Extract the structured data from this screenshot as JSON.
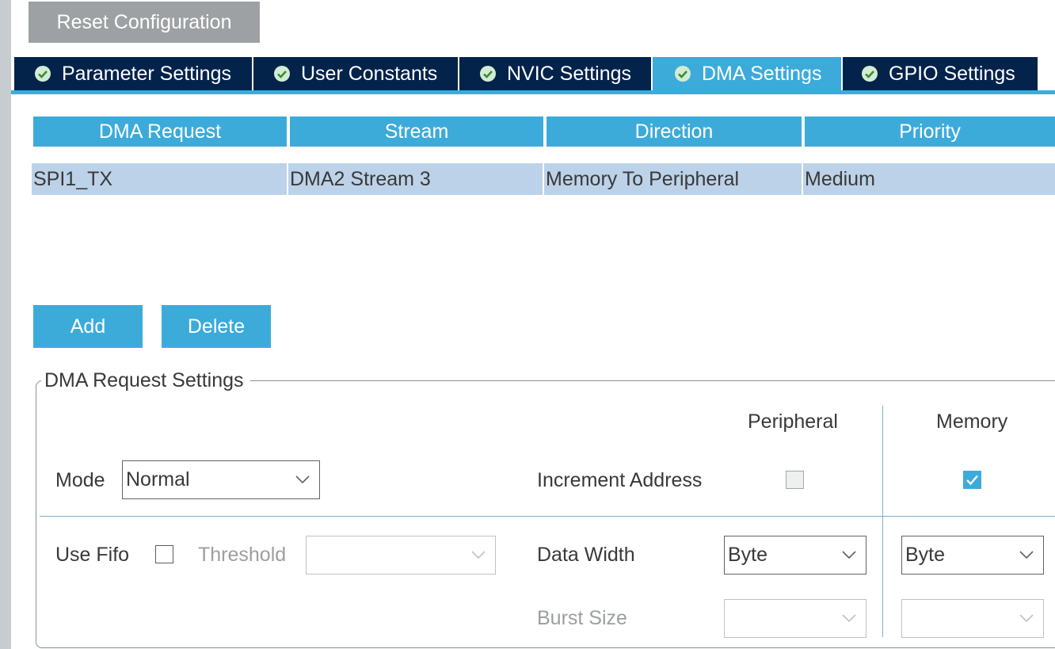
{
  "toolbar": {
    "reset_label": "Reset Configuration"
  },
  "tabs": [
    {
      "label": "Parameter Settings",
      "active": false,
      "icon": "check-circle-icon"
    },
    {
      "label": "User Constants",
      "active": false,
      "icon": "check-circle-icon"
    },
    {
      "label": "NVIC Settings",
      "active": false,
      "icon": "check-circle-icon"
    },
    {
      "label": "DMA Settings",
      "active": true,
      "icon": "check-circle-icon"
    },
    {
      "label": "GPIO Settings",
      "active": false,
      "icon": "check-circle-icon"
    }
  ],
  "dma_table": {
    "headers": [
      "DMA Request",
      "Stream",
      "Direction",
      "Priority"
    ],
    "rows": [
      [
        "SPI1_TX",
        "DMA2 Stream 3",
        "Memory To Peripheral",
        "Medium"
      ]
    ]
  },
  "actions": {
    "add_label": "Add",
    "delete_label": "Delete"
  },
  "settings": {
    "title": "DMA Request Settings",
    "peripheral_header": "Peripheral",
    "memory_header": "Memory",
    "mode_label": "Mode",
    "mode_value": "Normal",
    "increment_address_label": "Increment Address",
    "peripheral_increment": false,
    "memory_increment": true,
    "use_fifo_label": "Use Fifo",
    "use_fifo": false,
    "threshold_label": "Threshold",
    "threshold_value": "",
    "data_width_label": "Data Width",
    "peripheral_data_width": "Byte",
    "memory_data_width": "Byte",
    "burst_size_label": "Burst Size",
    "peripheral_burst_size": "",
    "memory_burst_size": ""
  },
  "colors": {
    "accent": "#3cabda",
    "tab_dark": "#03234b",
    "row_bg": "#bcd2e8",
    "reset_bg": "#9ea1a4"
  }
}
